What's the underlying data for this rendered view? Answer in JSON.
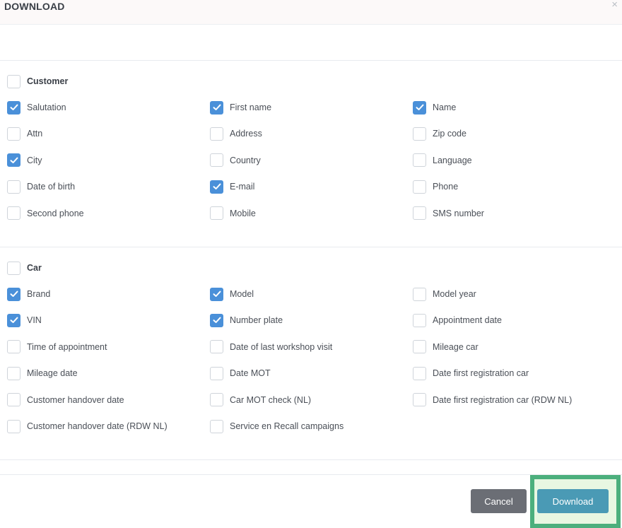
{
  "dialog": {
    "title": "DOWNLOAD",
    "close_symbol": "×"
  },
  "customer": {
    "header": "Customer",
    "header_checked": false,
    "rows": [
      [
        {
          "label": "Salutation",
          "checked": true
        },
        {
          "label": "First name",
          "checked": true
        },
        {
          "label": "Name",
          "checked": true
        }
      ],
      [
        {
          "label": "Attn",
          "checked": false
        },
        {
          "label": "Address",
          "checked": false
        },
        {
          "label": "Zip code",
          "checked": false
        }
      ],
      [
        {
          "label": "City",
          "checked": true
        },
        {
          "label": "Country",
          "checked": false
        },
        {
          "label": "Language",
          "checked": false
        }
      ],
      [
        {
          "label": "Date of birth",
          "checked": false
        },
        {
          "label": "E-mail",
          "checked": true
        },
        {
          "label": "Phone",
          "checked": false
        }
      ],
      [
        {
          "label": "Second phone",
          "checked": false
        },
        {
          "label": "Mobile",
          "checked": false
        },
        {
          "label": "SMS number",
          "checked": false
        }
      ]
    ]
  },
  "car": {
    "header": "Car",
    "header_checked": false,
    "rows": [
      [
        {
          "label": "Brand",
          "checked": true
        },
        {
          "label": "Model",
          "checked": true
        },
        {
          "label": "Model year",
          "checked": false
        }
      ],
      [
        {
          "label": "VIN",
          "checked": true
        },
        {
          "label": "Number plate",
          "checked": true
        },
        {
          "label": "Appointment date",
          "checked": false
        }
      ],
      [
        {
          "label": "Time of appointment",
          "checked": false
        },
        {
          "label": "Date of last workshop visit",
          "checked": false
        },
        {
          "label": "Mileage car",
          "checked": false
        }
      ],
      [
        {
          "label": "Mileage date",
          "checked": false
        },
        {
          "label": "Date MOT",
          "checked": false
        },
        {
          "label": "Date first registration car",
          "checked": false
        }
      ],
      [
        {
          "label": "Customer handover date",
          "checked": false
        },
        {
          "label": "Car MOT check (NL)",
          "checked": false
        },
        {
          "label": "Date first registration car (RDW NL)",
          "checked": false
        }
      ],
      [
        {
          "label": "Customer handover date (RDW NL)",
          "checked": false
        },
        {
          "label": "Service en Recall campaigns",
          "checked": false
        }
      ]
    ]
  },
  "footer": {
    "cancel_label": "Cancel",
    "download_label": "Download"
  },
  "colors": {
    "checked": "#4a90d9",
    "download_button": "#4a9ab5",
    "cancel_button": "#6b6e75",
    "highlight": "#4caf7d"
  }
}
